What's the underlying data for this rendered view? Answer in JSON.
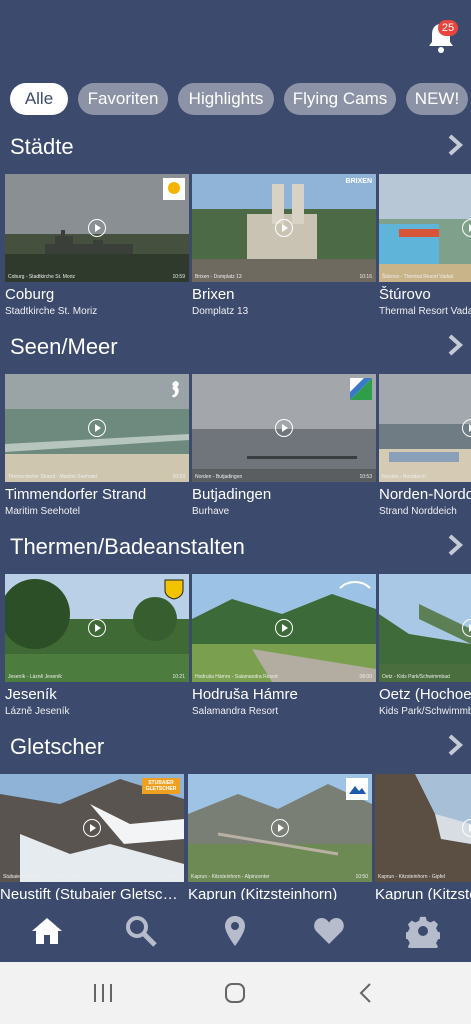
{
  "header": {
    "notification_count": "25",
    "bell_icon": "bell-icon"
  },
  "filters": [
    {
      "label": "Alle",
      "active": true
    },
    {
      "label": "Favoriten",
      "active": false
    },
    {
      "label": "Highlights",
      "active": false
    },
    {
      "label": "Flying Cams",
      "active": false
    },
    {
      "label": "NEW!",
      "active": false
    }
  ],
  "sections": [
    {
      "title": "Städte",
      "cards": [
        {
          "name": "Coburg",
          "sub": "Stadtkirche St. Moriz",
          "cap": "Coburg - Stadtkirche St. Moriz",
          "time": "10:59",
          "logo": "coburg-logo"
        },
        {
          "name": "Brixen",
          "sub": "Domplatz 13",
          "cap": "Brixen - Domplatz 13",
          "time": "10:16",
          "logo": "brixen-logo",
          "overlay": "BRIXEN"
        },
        {
          "name": "Štúrovo",
          "sub": "Thermal Resort Vadaš",
          "cap": "Štúrovo - Thermal Resort Vadaš",
          "time": ""
        }
      ]
    },
    {
      "title": "Seen/Meer",
      "cards": [
        {
          "name": "Timmendorfer Strand",
          "sub": "Maritim Seehotel",
          "cap": "Timmendorfer Strand - Maritim Seehotel",
          "time": "10:53",
          "logo": "seahorse-logo"
        },
        {
          "name": "Butjadingen",
          "sub": "Burhave",
          "cap": "Norden - Butjadingen",
          "time": "10:53",
          "logo": "flag-logo"
        },
        {
          "name": "Norden-Norddeich",
          "sub": "Strand Norddeich",
          "cap": "Norden - Norddeich",
          "time": ""
        }
      ]
    },
    {
      "title": "Thermen/Badeanstalten",
      "cards": [
        {
          "name": "Jeseník",
          "sub": "Lázně Jeseník",
          "cap": "Jeseník - Lázně Jeseník",
          "time": "10:21",
          "logo": "shield-logo"
        },
        {
          "name": "Hodruša Hámre",
          "sub": "Salamandra Resort",
          "cap": "Hodruša Hámre - Salamandra Resort",
          "time": "08:00",
          "logo": "salamandra-logo"
        },
        {
          "name": "Oetz (Hochoetz)",
          "sub": "Kids Park/Schwimmbad",
          "cap": "Oetz - Kids Park/Schwimmbad",
          "time": ""
        }
      ]
    },
    {
      "title": "Gletscher",
      "cards": [
        {
          "name": "Neustift (Stubaier Gletscher)",
          "sub": "",
          "cap": "Stubaier Gletscher 1.750m - 3.210m",
          "time": "10:54",
          "logo": "stubai-logo",
          "overlay": "STUBAIER GLETSCHER"
        },
        {
          "name": "Kaprun (Kitzsteinhorn)",
          "sub": "",
          "cap": "Kaprun - Kitzsteinhorn - Alpincenter",
          "time": "10:50",
          "logo": "kitzsteinhorn-logo"
        },
        {
          "name": "Kaprun (Kitzsteinhorn)",
          "sub": "",
          "cap": "Kaprun - Kitzsteinhorn - Gipfel",
          "time": ""
        }
      ]
    }
  ],
  "nav": [
    {
      "icon": "home-icon",
      "active": true
    },
    {
      "icon": "search-icon",
      "active": false
    },
    {
      "icon": "location-pin-icon",
      "active": false
    },
    {
      "icon": "heart-icon",
      "active": false
    },
    {
      "icon": "gear-icon",
      "active": false
    }
  ],
  "system_nav": [
    {
      "icon": "recent-apps-icon"
    },
    {
      "icon": "home-circle-icon"
    },
    {
      "icon": "back-icon"
    }
  ],
  "colors": {
    "background": "#3c4a6e",
    "chip": "#8c93a6",
    "chip_active": "#ffffff",
    "badge": "#e8453c"
  }
}
